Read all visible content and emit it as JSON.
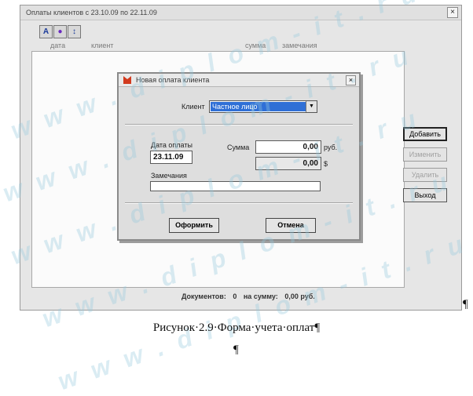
{
  "window": {
    "title": "Оплаты клиентов с 23.10.09 по 22.11.09",
    "close_glyph": "×"
  },
  "toolbar": {
    "buttons": [
      {
        "icon": "font-icon",
        "glyph": "A"
      },
      {
        "icon": "palette-icon",
        "glyph": "●"
      },
      {
        "icon": "sort-icon",
        "glyph": "↕"
      }
    ]
  },
  "grid": {
    "columns": [
      "дата",
      "клиент",
      "сумма",
      "замечания"
    ]
  },
  "side_buttons": {
    "add": "Добавить",
    "edit": "Изменить",
    "delete": "Удалить",
    "exit": "Выход"
  },
  "footer": {
    "documents_label": "Документов:",
    "documents_count": "0",
    "sum_label": "на сумму:",
    "sum_value": "0,00 руб."
  },
  "dialog": {
    "title": "Новая оплата клиента",
    "close_glyph": "×",
    "client_label": "Клиент",
    "client_value": "Частное лицо",
    "date_label": "Дата оплаты",
    "date_value": "23.11.09",
    "sum_label": "Сумма",
    "sum_value": "0,00",
    "sum_currency": "руб.",
    "usd_value": "0,00",
    "usd_currency": "$",
    "notes_label": "Замечания",
    "notes_value": "",
    "ok_label": "Оформить",
    "cancel_label": "Отмена"
  },
  "document": {
    "caption": "Рисунок·2.9·Форма·учета·оплат¶",
    "pilcrow": "¶"
  },
  "watermark": {
    "text": "w w w . d i p l o m - i t . r u",
    "color": "#96c8dc"
  }
}
